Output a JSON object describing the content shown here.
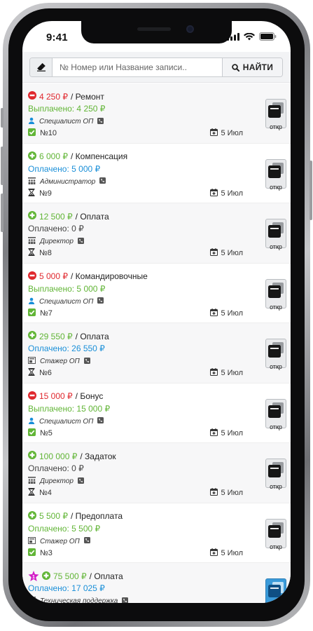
{
  "status_bar": {
    "time": "9:41"
  },
  "search": {
    "placeholder": "№ Номер или Название записи..",
    "button_label": "НАЙТИ"
  },
  "colors": {
    "expense_red": "#e0282e",
    "income_green": "#61b536",
    "paid_blue": "#1a8fd8",
    "badge_magenta": "#d21cc7"
  },
  "records": [
    {
      "type": "expense",
      "amount": "4 250 ₽",
      "category": "/ Ремонт",
      "status_text": "Выплачено: 4 250 ₽",
      "status_color": "green",
      "role": "Специалист ОП",
      "role_icon": "user-icon",
      "id_text": "№10",
      "id_icon": "check-square-icon",
      "date": "5 Июл",
      "open_label": "откр"
    },
    {
      "type": "income",
      "amount": "6 000 ₽",
      "category": "/ Компенсация",
      "status_text": "Оплачено: 5 000 ₽",
      "status_color": "blue",
      "role": "Администратор",
      "role_icon": "users-icon",
      "id_text": "№9",
      "id_icon": "hourglass-icon",
      "date": "5 Июл",
      "open_label": "откр"
    },
    {
      "type": "income",
      "amount": "12 500 ₽",
      "category": "/ Оплата",
      "status_text": "Оплачено: 0 ₽",
      "status_color": "gray",
      "role": "Директор",
      "role_icon": "users-icon",
      "id_text": "№8",
      "id_icon": "hourglass-icon",
      "date": "5 Июл",
      "open_label": "откр"
    },
    {
      "type": "expense",
      "amount": "5 000 ₽",
      "category": "/ Командировочные",
      "status_text": "Выплачено: 5 000 ₽",
      "status_color": "green",
      "role": "Специалист ОП",
      "role_icon": "user-icon",
      "id_text": "№7",
      "id_icon": "check-square-icon",
      "date": "5 Июл",
      "open_label": "откр"
    },
    {
      "type": "income",
      "amount": "29 550 ₽",
      "category": "/ Оплата",
      "status_text": "Оплачено: 26 550 ₽",
      "status_color": "blue",
      "role": "Стажер ОП",
      "role_icon": "trainee-icon",
      "id_text": "№6",
      "id_icon": "hourglass-icon",
      "date": "5 Июл",
      "open_label": "откр"
    },
    {
      "type": "expense",
      "amount": "15 000 ₽",
      "category": "/ Бонус",
      "status_text": "Выплачено: 15 000 ₽",
      "status_color": "green",
      "role": "Специалист ОП",
      "role_icon": "user-icon",
      "id_text": "№5",
      "id_icon": "check-square-icon",
      "date": "5 Июл",
      "open_label": "откр"
    },
    {
      "type": "income",
      "amount": "100 000 ₽",
      "category": "/ Задаток",
      "status_text": "Оплачено: 0 ₽",
      "status_color": "gray",
      "role": "Директор",
      "role_icon": "users-icon",
      "id_text": "№4",
      "id_icon": "hourglass-icon",
      "date": "5 Июл",
      "open_label": "откр"
    },
    {
      "type": "income",
      "amount": "5 500 ₽",
      "category": "/ Предоплата",
      "status_text": "Оплачено: 5 500 ₽",
      "status_color": "green",
      "role": "Стажер ОП",
      "role_icon": "trainee-icon",
      "id_text": "№3",
      "id_icon": "check-square-icon",
      "date": "5 Июл",
      "open_label": "откр"
    },
    {
      "type": "income",
      "amount": "75 500 ₽",
      "category": "/ Оплата",
      "status_text": "Оплачено: 17 025 ₽",
      "status_color": "blue",
      "role": "Техническая поддержка",
      "role_icon": "users-icon",
      "id_text": "",
      "id_icon": "",
      "date": "",
      "open_label": "",
      "badge": "star-badge-icon",
      "highlight": true
    }
  ]
}
